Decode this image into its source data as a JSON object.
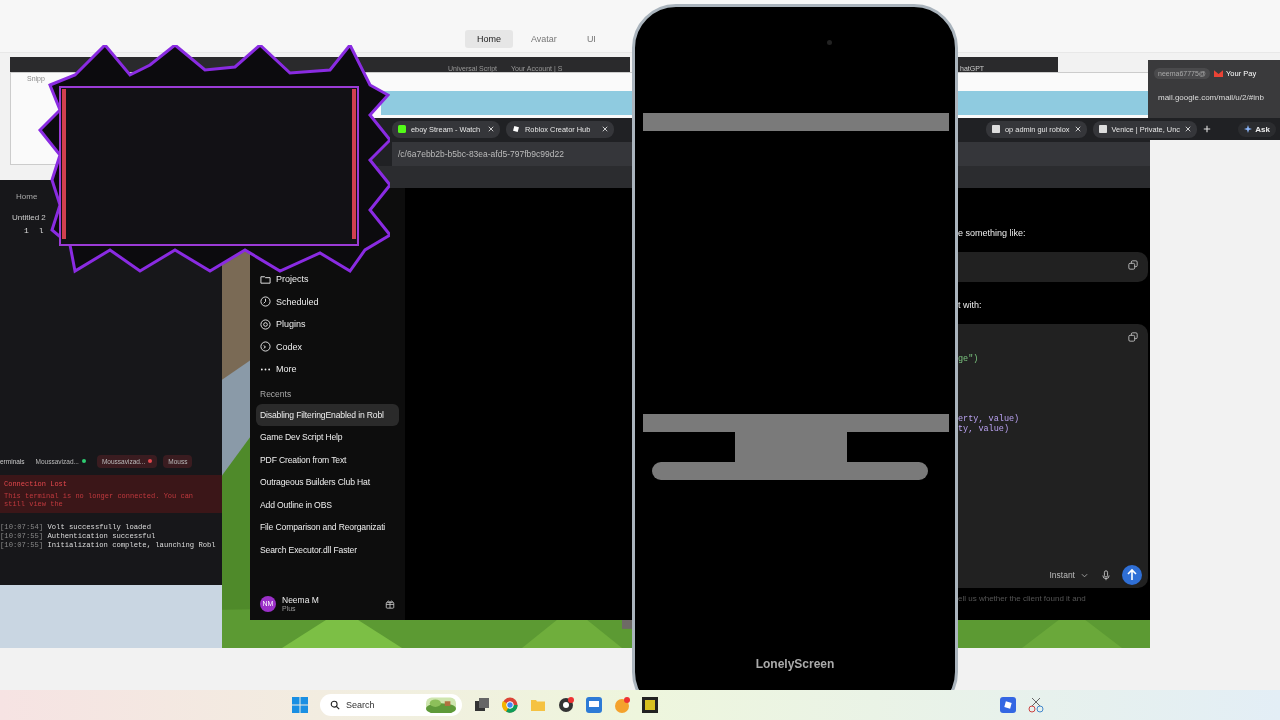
{
  "studio_tabs": [
    {
      "label": "Home",
      "selected": true
    },
    {
      "label": "Avatar",
      "selected": false
    },
    {
      "label": "UI",
      "selected": false
    }
  ],
  "back_tabs": [
    {
      "title": "Universal Script"
    },
    {
      "title": "Your Account | S"
    }
  ],
  "back_right_tab": {
    "title": "hatGPT"
  },
  "snipping_tool": {
    "title": "Snipp"
  },
  "gmail": {
    "account_tab": "neema67775@",
    "tab": "Your Pay",
    "url": "mail.google.com/mail/u/2/#inb"
  },
  "browser": {
    "tabs": [
      {
        "title": "eboy Stream - Watch"
      },
      {
        "title": "Roblox Creator Hub"
      },
      {
        "title": "op admin gui roblox"
      },
      {
        "title": "Venice | Private, Unc"
      }
    ],
    "ask_button": "Ask",
    "url": "/c/6a7ebb2b-b5bc-83ea-afd5-797fb9c99d22"
  },
  "sidebar": {
    "items": [
      {
        "label": "Projects"
      },
      {
        "label": "Scheduled"
      },
      {
        "label": "Plugins"
      },
      {
        "label": "Codex"
      },
      {
        "label": "More"
      }
    ],
    "recents_heading": "Recents",
    "recents": [
      {
        "title": "Disabling FilteringEnabled in Robl",
        "selected": true
      },
      {
        "title": "Game Dev Script Help",
        "selected": false
      },
      {
        "title": "PDF Creation from Text",
        "selected": false
      },
      {
        "title": "Outrageous Builders Club Hat",
        "selected": false
      },
      {
        "title": "Add Outline in OBS",
        "selected": false
      },
      {
        "title": "File Comparison and Reorganizati",
        "selected": false
      },
      {
        "title": "Search Executor.dll Faster",
        "selected": false
      }
    ],
    "user": {
      "initials": "NM",
      "name": "Neema M",
      "plan": "Plus"
    }
  },
  "chat": {
    "intro": "e something like:",
    "second_intro": "t with:",
    "code_groups": [
      [
        {
          "text": "ge\")",
          "kind": "string"
        }
      ],
      [
        {
          "text": "erty, value)",
          "kind": "call"
        },
        {
          "text": "ty, value)",
          "kind": "call"
        }
      ]
    ],
    "mode": "Instant",
    "footer": "ell us whether the client found it and"
  },
  "editor": {
    "home": "Home",
    "file": "Untitled 2",
    "lines": [
      {
        "number": "1",
        "text": "l"
      }
    ],
    "terminals_label": "erminals",
    "terminal_tabs": [
      {
        "label": "Moussavizad...",
        "color": "#2ecc71",
        "disconnected": false
      },
      {
        "label": "Moussavizad...",
        "color": "#e5484d",
        "disconnected": true
      },
      {
        "label": "Mouss",
        "disconnected": true
      }
    ],
    "alert": {
      "title": "Connection Lost",
      "message": "This terminal is no longer connected. You can still view the"
    },
    "logs": [
      {
        "time": "[10:07:54]",
        "text": "Volt successfully loaded"
      },
      {
        "time": "[10:07:55]",
        "text": "Authentication successful"
      },
      {
        "time": "[10:07:55]",
        "text": "Initialization complete, launching Robl"
      }
    ]
  },
  "phone": {
    "app": "LonelyScreen"
  },
  "taskbar": {
    "search_placeholder": "Search"
  }
}
